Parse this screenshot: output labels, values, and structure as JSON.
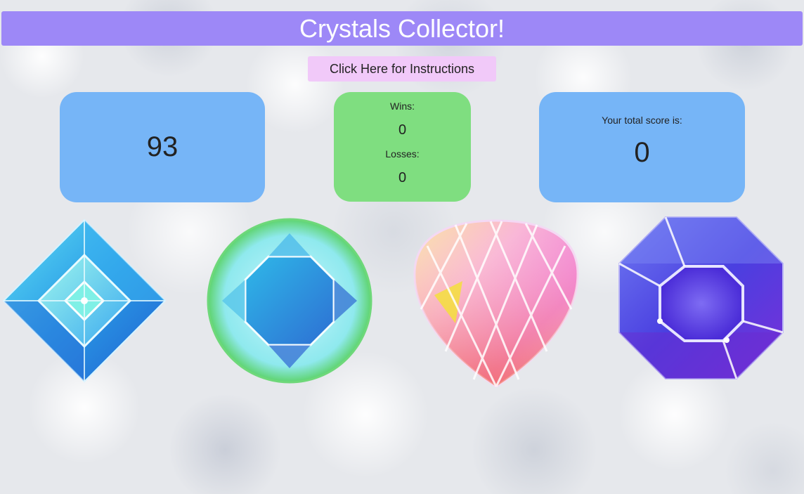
{
  "header": {
    "title": "Crystals Collector!"
  },
  "instructions_button": {
    "label": "Click Here for Instructions"
  },
  "target": {
    "value": "93"
  },
  "record": {
    "wins_label": "Wins:",
    "wins_value": "0",
    "losses_label": "Losses:",
    "losses_value": "0"
  },
  "score": {
    "label": "Your total score is:",
    "value": "0"
  },
  "crystals": [
    {
      "icon": "blue-square-crystal-icon"
    },
    {
      "icon": "teal-round-crystal-icon"
    },
    {
      "icon": "pink-heart-crystal-icon"
    },
    {
      "icon": "purple-octagon-crystal-icon"
    }
  ],
  "colors": {
    "header": "#9d88f7",
    "button": "#f1c9f9",
    "blue_panel": "#76b5f7",
    "green_panel": "#7fde80"
  }
}
